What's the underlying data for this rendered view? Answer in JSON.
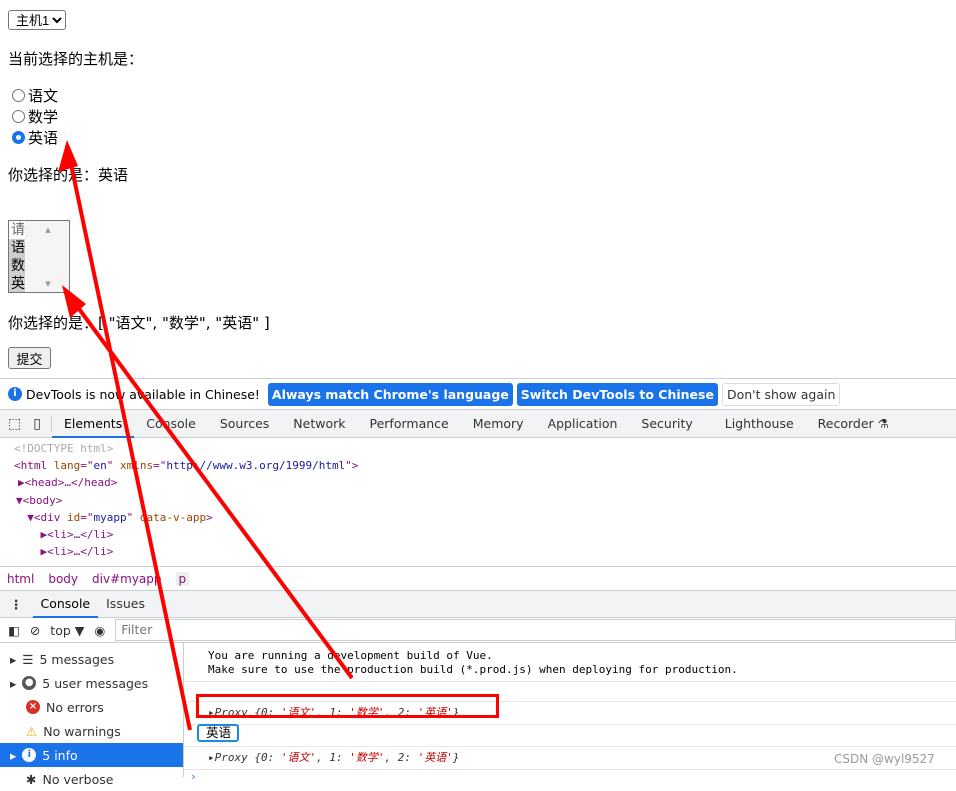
{
  "page": {
    "host_select": "主机1",
    "host_label": "当前选择的主机是：",
    "radios": [
      {
        "label": "语文",
        "checked": false
      },
      {
        "label": "数学",
        "checked": false
      },
      {
        "label": "英语",
        "checked": true
      }
    ],
    "radio_result": "你选择的是：英语",
    "listbox": {
      "placeholder": "请选择",
      "options": [
        {
          "label": "语文",
          "selected": true
        },
        {
          "label": "数学",
          "selected": true
        },
        {
          "label": "英语",
          "selected": true
        }
      ]
    },
    "list_result": "你选择的是：[ \"语文\", \"数学\", \"英语\" ]",
    "submit": "提交"
  },
  "infobar": {
    "text": "DevTools is now available in Chinese!",
    "btn1": "Always match Chrome's language",
    "btn2": "Switch DevTools to Chinese",
    "btn3": "Don't show again"
  },
  "tabs": [
    "Elements",
    "Console",
    "Sources",
    "Network",
    "Performance",
    "Memory",
    "Application",
    "Security",
    "Lighthouse",
    "Recorder"
  ],
  "tree": {
    "l0": "<!DOCTYPE html>",
    "l1a": "<html ",
    "l1b": "lang",
    "l1c": "=\"",
    "l1d": "en",
    "l1e": "\" ",
    "l1f": "xmlns",
    "l1g": "=\"",
    "l1h": "http://www.w3.org/1999/html",
    "l1i": "\">",
    "l2": "▶<head>…</head>",
    "l3": "▼<body>",
    "l4a": "  ▼<div ",
    "l4b": "id",
    "l4c": "=\"",
    "l4d": "myapp",
    "l4e": "\" ",
    "l4f": "data-v-app",
    "l4g": ">",
    "l5": "    ▶<li>…</li>",
    "l6": "    ▶<li>…</li>"
  },
  "breadcrumb": [
    "html",
    "body",
    "div#myapp",
    "p"
  ],
  "drawer_tabs": [
    "Console",
    "Issues"
  ],
  "console_toolbar": {
    "context": "top ▼",
    "filter_placeholder": "Filter"
  },
  "sidebar": [
    {
      "label": "5 messages",
      "icon": "list-icon"
    },
    {
      "label": "5 user messages",
      "icon": "user-icon"
    },
    {
      "label": "No errors",
      "icon": "error-icon"
    },
    {
      "label": "No warnings",
      "icon": "warning-icon"
    },
    {
      "label": "5 info",
      "icon": "info-icon",
      "active": true
    },
    {
      "label": "No verbose",
      "icon": "bug-icon"
    }
  ],
  "messages": {
    "vue_warn1": "You are running a development build of Vue.",
    "vue_warn2": "Make sure to use the production build (*.prod.js) when deploying for production.",
    "proxy_prefix": "Proxy {0: ",
    "s0": "'语文'",
    "m1": ", 1: ",
    "s1": "'数学'",
    "m2": ", 2: ",
    "s2": "'英语'",
    "proxy_suffix": "}",
    "value": "英语"
  },
  "watermark": "CSDN @wyl9527",
  "colors": {
    "accent": "#1a73e8",
    "annotation": "#ff0000"
  }
}
